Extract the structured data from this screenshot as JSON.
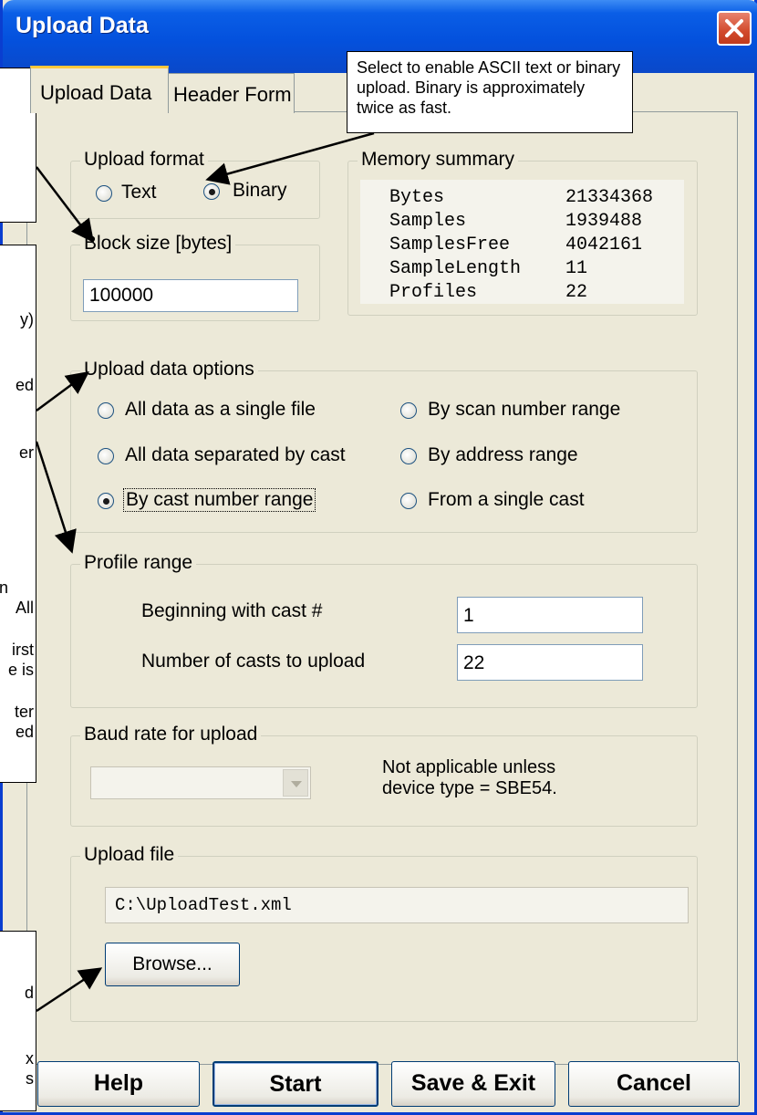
{
  "window": {
    "title": "Upload Data"
  },
  "tabs": [
    {
      "label": "Upload Data"
    },
    {
      "label": "Header Form"
    }
  ],
  "upload_format": {
    "label": "Upload format",
    "options": [
      {
        "label": "Text",
        "selected": false
      },
      {
        "label": "Binary",
        "selected": true
      }
    ]
  },
  "block_size": {
    "label": "Block size [bytes]",
    "value": "100000"
  },
  "memory_summary": {
    "label": "Memory summary",
    "rows": [
      {
        "name": "Bytes",
        "value": "21334368"
      },
      {
        "name": "Samples",
        "value": "1939488"
      },
      {
        "name": "SamplesFree",
        "value": "4042161"
      },
      {
        "name": "SampleLength",
        "value": "11"
      },
      {
        "name": "Profiles",
        "value": "22"
      }
    ]
  },
  "upload_options": {
    "label": "Upload data options",
    "options": [
      {
        "label": "All data as a single file",
        "selected": false
      },
      {
        "label": "By scan number range",
        "selected": false
      },
      {
        "label": "All data separated by cast",
        "selected": false
      },
      {
        "label": "By address range",
        "selected": false
      },
      {
        "label": "By cast number range",
        "selected": true
      },
      {
        "label": "From a single cast",
        "selected": false
      }
    ]
  },
  "profile_range": {
    "label": "Profile range",
    "begin_label": "Beginning with cast #",
    "begin_value": "1",
    "count_label": "Number of casts to upload",
    "count_value": "22"
  },
  "baud": {
    "label": "Baud rate for upload",
    "note": "Not applicable unless device type = SBE54."
  },
  "upload_file": {
    "label": "Upload file",
    "path": "C:\\UploadTest.xml",
    "browse_label": "Browse..."
  },
  "buttons": {
    "help": "Help",
    "start": "Start",
    "save_exit": "Save & Exit",
    "cancel": "Cancel"
  },
  "callouts": {
    "top_right": "Select to enable ASCII text or binary upload. Binary is approximately twice as fast.",
    "left_mid": [
      "y)",
      "ed",
      "er",
      "n",
      "All",
      "irst",
      "e is",
      "ter",
      "ed"
    ],
    "left_bottom": [
      "d",
      "x",
      "s"
    ]
  }
}
